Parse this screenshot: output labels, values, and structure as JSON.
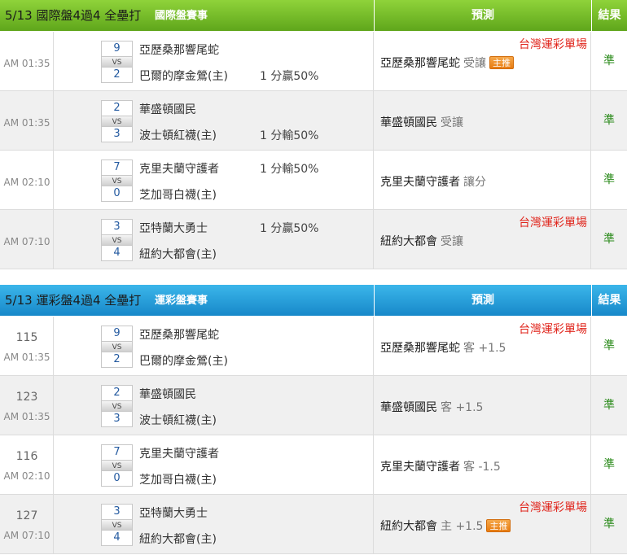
{
  "intl": {
    "title": "5/13 國際盤4過4 全壘打",
    "subtitle": "國際盤賽事",
    "pred_header": "預測",
    "result_header": "結果",
    "header_color": "#6db425",
    "rows": [
      {
        "time": "AM 01:35",
        "score1": "9",
        "score2": "2",
        "team1": "亞歷桑那響尾蛇",
        "team2": "巴爾的摩金鶯(主)",
        "hcp1": "",
        "hcp2": "1 分贏50%",
        "tag": "台灣運彩單場",
        "pick": "亞歷桑那響尾蛇",
        "note": "受讓",
        "badge": "主推",
        "result": "準"
      },
      {
        "time": "AM 01:35",
        "score1": "2",
        "score2": "3",
        "team1": "華盛頓國民",
        "team2": "波士頓紅襪(主)",
        "hcp1": "",
        "hcp2": "1 分輸50%",
        "tag": "",
        "pick": "華盛頓國民",
        "note": "受讓",
        "badge": "",
        "result": "準"
      },
      {
        "time": "AM 02:10",
        "score1": "7",
        "score2": "0",
        "team1": "克里夫蘭守護者",
        "team2": "芝加哥白襪(主)",
        "hcp1": "1 分輸50%",
        "hcp2": "",
        "tag": "",
        "pick": "克里夫蘭守護者",
        "note": "讓分",
        "badge": "",
        "result": "準"
      },
      {
        "time": "AM 07:10",
        "score1": "3",
        "score2": "4",
        "team1": "亞特蘭大勇士",
        "team2": "紐約大都會(主)",
        "hcp1": "1 分贏50%",
        "hcp2": "",
        "tag": "台灣運彩單場",
        "pick": "紐約大都會",
        "note": "受讓",
        "badge": "",
        "result": "準"
      }
    ]
  },
  "lottery": {
    "title": "5/13 運彩盤4過4 全壘打",
    "subtitle": "運彩盤賽事",
    "pred_header": "預測",
    "result_header": "結果",
    "header_color": "#2a9fdc",
    "rows": [
      {
        "num": "115",
        "time": "AM 01:35",
        "score1": "9",
        "score2": "2",
        "team1": "亞歷桑那響尾蛇",
        "team2": "巴爾的摩金鶯(主)",
        "tag": "台灣運彩單場",
        "pick": "亞歷桑那響尾蛇",
        "note": "客 +1.5",
        "badge": "",
        "result": "準"
      },
      {
        "num": "123",
        "time": "AM 01:35",
        "score1": "2",
        "score2": "3",
        "team1": "華盛頓國民",
        "team2": "波士頓紅襪(主)",
        "tag": "",
        "pick": "華盛頓國民",
        "note": "客 +1.5",
        "badge": "",
        "result": "準"
      },
      {
        "num": "116",
        "time": "AM 02:10",
        "score1": "7",
        "score2": "0",
        "team1": "克里夫蘭守護者",
        "team2": "芝加哥白襪(主)",
        "tag": "",
        "pick": "克里夫蘭守護者",
        "note": "客 -1.5",
        "badge": "",
        "result": "準"
      },
      {
        "num": "127",
        "time": "AM 07:10",
        "score1": "3",
        "score2": "4",
        "team1": "亞特蘭大勇士",
        "team2": "紐約大都會(主)",
        "tag": "台灣運彩單場",
        "pick": "紐約大都會",
        "note": "主 +1.5",
        "badge": "主推",
        "result": "準"
      }
    ]
  }
}
